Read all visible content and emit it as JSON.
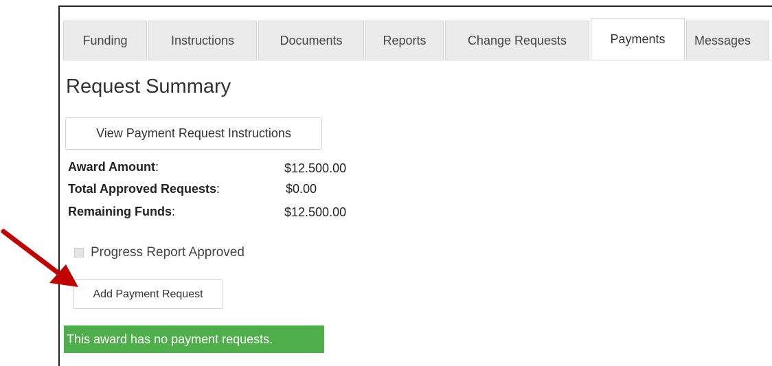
{
  "tabs": [
    {
      "label": "Funding",
      "active": false
    },
    {
      "label": "Instructions",
      "active": false
    },
    {
      "label": "Documents",
      "active": false
    },
    {
      "label": "Reports",
      "active": false
    },
    {
      "label": "Change Requests",
      "active": false
    },
    {
      "label": "Payments",
      "active": true
    },
    {
      "label": "Messages",
      "active": false
    }
  ],
  "main": {
    "heading": "Request Summary",
    "instructions_button": "View Payment Request Instructions",
    "summary": {
      "award_amount_label": "Award Amount",
      "award_amount_value": "$12.500.00",
      "total_approved_label": "Total Approved Requests",
      "total_approved_value": "$0.00",
      "remaining_label": "Remaining Funds",
      "remaining_value": "$12.500.00"
    },
    "progress_checkbox_label": "Progress Report Approved",
    "add_button": "Add Payment Request",
    "alert": "This award has no payment requests."
  },
  "colors": {
    "alert_bg": "#4dae4a",
    "arrow": "#c00000"
  },
  "icons": {
    "annotation": "red-arrow-icon"
  }
}
